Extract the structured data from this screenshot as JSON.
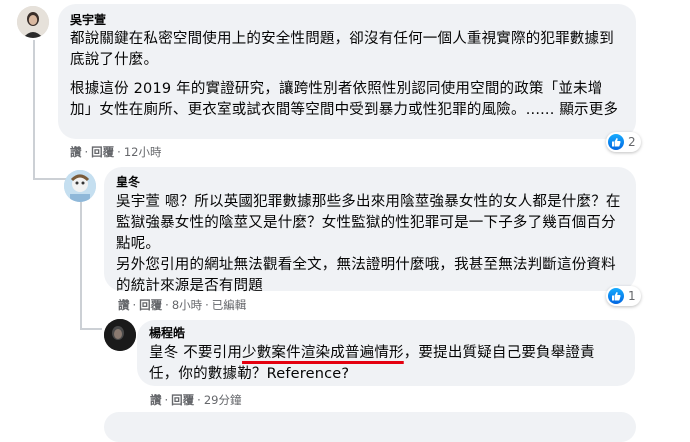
{
  "comments": [
    {
      "author": "吳宇萱",
      "paragraphs": [
        "都說關鍵在私密空間使用上的安全性問題，卻沒有任何一個人重視實際的犯罪數據到底說了什麼。",
        "根據這份 2019 年的實證研究，讓跨性別者依照性別認同使用空間的政策「並未增加」女性在廁所、更衣室或試衣間等空間中受到暴力或性犯罪的風險。...... 顯示更多"
      ],
      "actions": {
        "like": "讚",
        "reply": "回覆",
        "time": "12小時"
      },
      "reaction_count": "2"
    },
    {
      "author": "皇冬",
      "paragraphs": [
        "吳宇萱 嗯？所以英國犯罪數據那些多出來用陰莖強暴女性的女人都是什麼？在監獄強暴女性的陰莖又是什麼？女性監獄的性犯罪可是一下子多了幾百個百分點呢。",
        "另外您引用的網址無法觀看全文，無法證明什麼哦，我甚至無法判斷這份資料的統計來源是否有問題"
      ],
      "actions": {
        "like": "讚",
        "reply": "回覆",
        "time": "8小時",
        "edited": "已編輯"
      },
      "reaction_count": "1"
    },
    {
      "author": "楊程皓",
      "mention": "皇冬",
      "text_before": "不要引用",
      "text_highlight": "少數案件渲染成普遍情形",
      "text_after": "，要提出質疑自己要負舉證責任，你的數據勒？Reference?",
      "actions": {
        "like": "讚",
        "reply": "回覆",
        "time": "29分鐘"
      }
    }
  ],
  "colors": {
    "bubble": "#f0f2f5",
    "meta": "#65676b",
    "like": "#0165e1",
    "underline": "#e4000f"
  }
}
